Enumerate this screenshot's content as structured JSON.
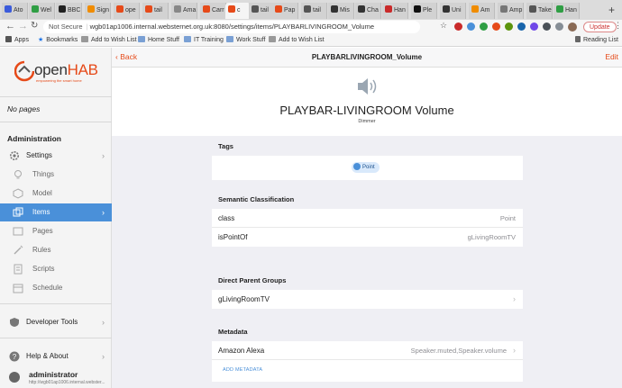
{
  "browser": {
    "tabs": [
      {
        "label": "Ato",
        "color": "#3b5bdb"
      },
      {
        "label": "Wel",
        "color": "#2f9e44"
      },
      {
        "label": "BBC",
        "color": "#222222"
      },
      {
        "label": "Sign",
        "color": "#f08c00"
      },
      {
        "label": "ope",
        "color": "#e64a19"
      },
      {
        "label": "tail",
        "color": "#e64a19"
      },
      {
        "label": "Ama",
        "color": "#888888"
      },
      {
        "label": "Carr",
        "color": "#e64a19"
      },
      {
        "label": "c",
        "color": "#e64a19"
      },
      {
        "label": "tail",
        "color": "#555555"
      },
      {
        "label": "Pap",
        "color": "#e64a19"
      },
      {
        "label": "tail",
        "color": "#555555"
      },
      {
        "label": "Mis",
        "color": "#333333"
      },
      {
        "label": "Cha",
        "color": "#333333"
      },
      {
        "label": "Han",
        "color": "#c92a2a"
      },
      {
        "label": "Ple",
        "color": "#111111"
      },
      {
        "label": "Uni",
        "color": "#333333"
      },
      {
        "label": "Am",
        "color": "#f08c00"
      },
      {
        "label": "Amp",
        "color": "#777777"
      },
      {
        "label": "Take",
        "color": "#555555"
      },
      {
        "label": "Han",
        "color": "#2f9e44"
      }
    ],
    "not_secure": "Not Secure",
    "url": "wgb01ap1006.internal.websternet.org.uk:8080/settings/items/PLAYBARLIVINGROOM_Volume",
    "update_label": "Update",
    "bookmarks": [
      "Apps",
      "Bookmarks",
      "Add to Wish List",
      "Home Stuff",
      "IT Training",
      "Work Stuff",
      "Add to Wish List"
    ],
    "reading_list": "Reading List"
  },
  "sidebar": {
    "logo_main": "open",
    "logo_accent": "HAB",
    "logo_tagline": "empowering the smart home",
    "no_pages": "No pages",
    "admin_title": "Administration",
    "items": [
      {
        "label": "Settings",
        "icon": "gear-icon"
      },
      {
        "label": "Things",
        "icon": "lightbulb-icon"
      },
      {
        "label": "Model",
        "icon": "cube-icon"
      },
      {
        "label": "Items",
        "icon": "square-stack-icon"
      },
      {
        "label": "Pages",
        "icon": "page-icon"
      },
      {
        "label": "Rules",
        "icon": "wand-icon"
      },
      {
        "label": "Scripts",
        "icon": "doc-icon"
      },
      {
        "label": "Schedule",
        "icon": "calendar-icon"
      }
    ],
    "developer_tools": "Developer Tools",
    "help_about": "Help & About",
    "user": "administrator",
    "user_url": "http://wgb01ap1006.internal.webster..."
  },
  "main": {
    "back": "Back",
    "nav_title": "PLAYBARLIVINGROOM_Volume",
    "edit": "Edit",
    "item_title": "PLAYBAR-LIVINGROOM Volume",
    "item_type": "Dimmer",
    "tags_title": "Tags",
    "tag": "Point",
    "semantic_title": "Semantic Classification",
    "semantic_rows": [
      {
        "label": "class",
        "value": "Point"
      },
      {
        "label": "isPointOf",
        "value": "gLivingRoomTV"
      }
    ],
    "parent_title": "Direct Parent Groups",
    "parent_group": "gLivingRoomTV",
    "metadata_title": "Metadata",
    "metadata_label": "Amazon Alexa",
    "metadata_value": "Speaker.muted,Speaker.volume",
    "add_metadata": "ADD METADATA"
  }
}
